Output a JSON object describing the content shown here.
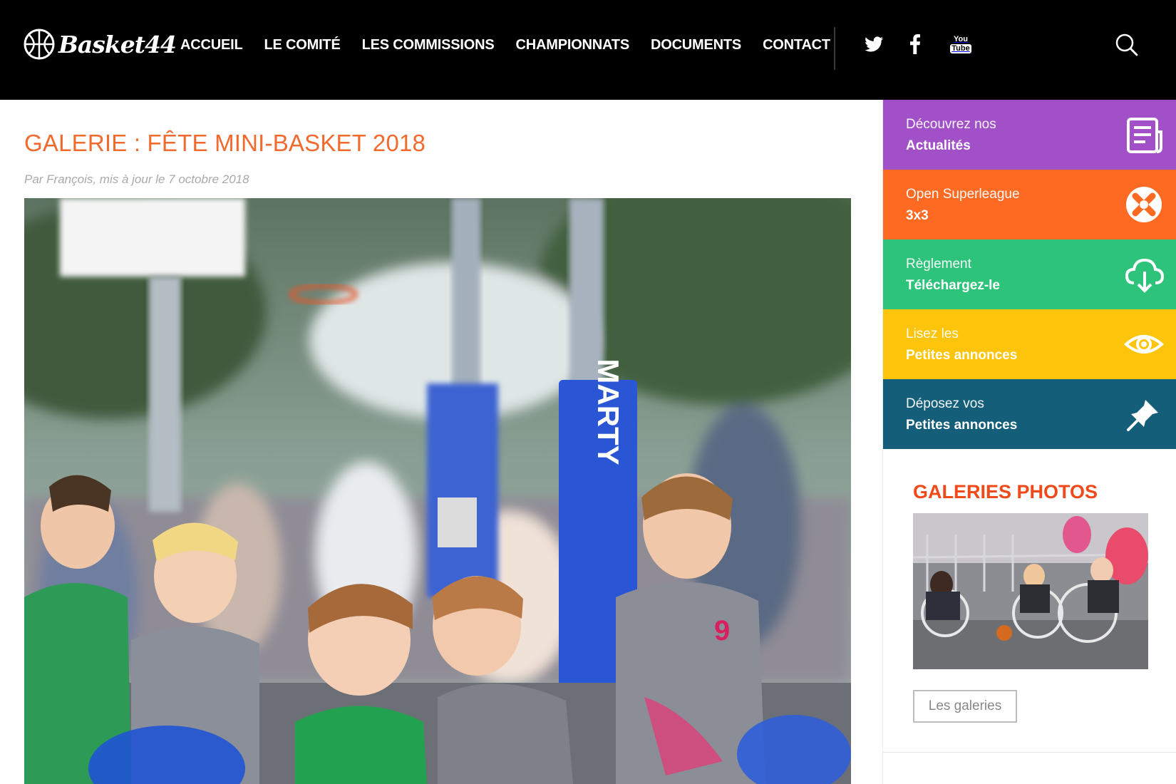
{
  "site": {
    "logo_text": "Basket44"
  },
  "nav": {
    "items": [
      {
        "label": "ACCUEIL"
      },
      {
        "label": "LE COMITÉ"
      },
      {
        "label": "LES COMMISSIONS"
      },
      {
        "label": "CHAMPIONNATS"
      },
      {
        "label": "DOCUMENTS"
      },
      {
        "label": "CONTACT"
      }
    ],
    "social": [
      {
        "icon": "twitter-icon"
      },
      {
        "icon": "facebook-icon"
      },
      {
        "icon": "youtube-icon",
        "line1": "You",
        "line2": "Tube"
      }
    ],
    "search_icon": "search-icon"
  },
  "article": {
    "title": "GALERIE : FÊTE MINI-BASKET 2018",
    "byline": "Par François, mis à jour le 7 octobre 2018",
    "hero_alt": "Mini-basket photo"
  },
  "sidebar": {
    "tiles": [
      {
        "sub": "Découvrez nos",
        "main": "Actualités",
        "icon": "newspaper-icon",
        "color": "#a250c8"
      },
      {
        "sub": "Open Superleague",
        "main": "3x3",
        "icon": "3x3-logo-icon",
        "color": "#ff6a23"
      },
      {
        "sub": "Règlement",
        "main": "Téléchargez-le",
        "icon": "cloud-download-icon",
        "color": "#2ec37a"
      },
      {
        "sub": "Lisez les",
        "main": "Petites annonces",
        "icon": "eye-icon",
        "color": "#fcc40a"
      },
      {
        "sub": "Déposez vos",
        "main": "Petites annonces",
        "icon": "pin-icon",
        "color": "#145e7a"
      }
    ],
    "galleries": {
      "title": "GALERIES PHOTOS",
      "button": "Les galeries"
    }
  },
  "colors": {
    "header_bg": "#000000",
    "title_orange": "#f26a2e",
    "gallery_title": "#f04a1a"
  }
}
